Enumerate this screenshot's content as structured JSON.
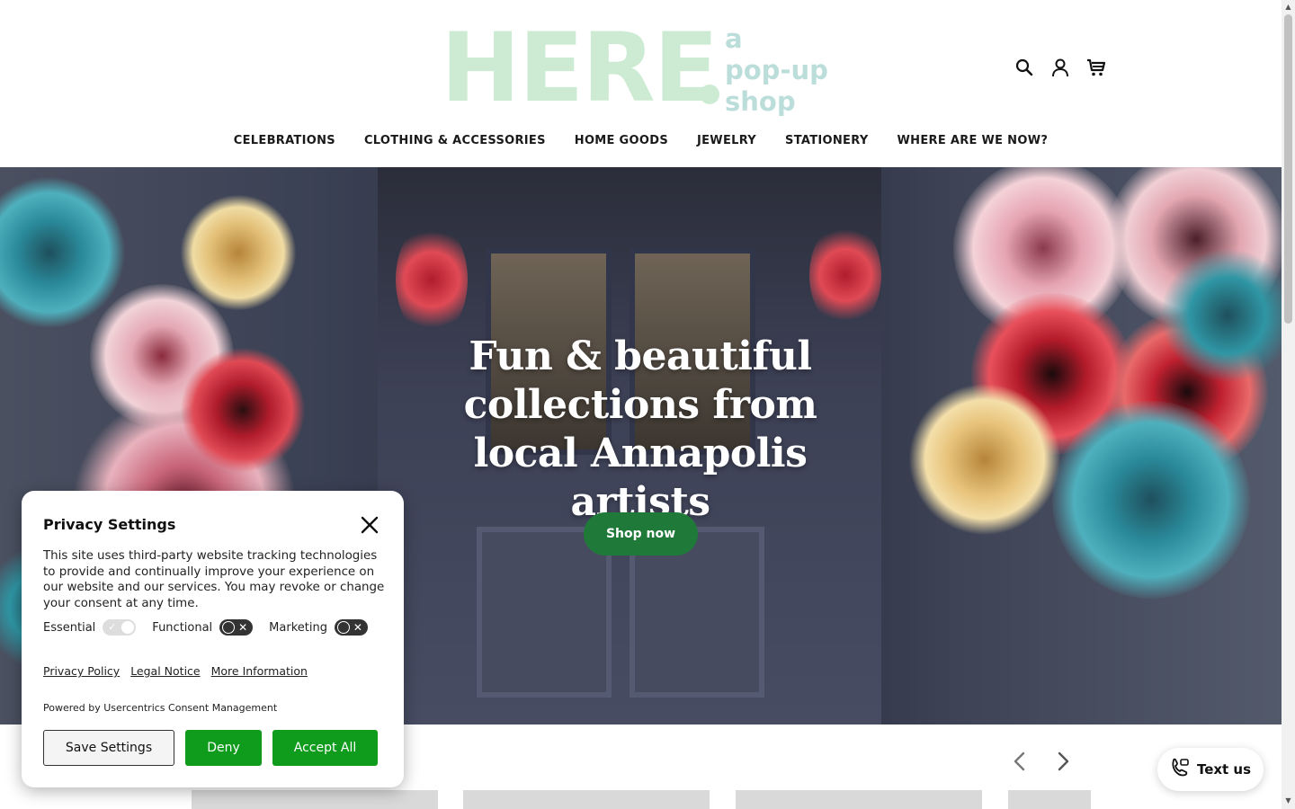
{
  "header": {
    "logo_main": "HERE",
    "logo_sub_lines": [
      "a",
      "pop-up",
      "shop"
    ],
    "icons": [
      "search-icon",
      "account-icon",
      "cart-icon"
    ]
  },
  "nav": {
    "items": [
      {
        "label": "CELEBRATIONS"
      },
      {
        "label": "CLOTHING & ACCESSORIES"
      },
      {
        "label": "HOME GOODS"
      },
      {
        "label": "JEWELRY"
      },
      {
        "label": "STATIONERY"
      },
      {
        "label": "WHERE ARE WE NOW?"
      }
    ]
  },
  "hero": {
    "title": "Fun & beautiful collections from local Annapolis artists",
    "cta_label": "Shop now"
  },
  "carousel": {
    "prev_icon": "chevron-left-icon",
    "next_icon": "chevron-right-icon"
  },
  "text_us": {
    "label": "Text us",
    "icon": "phone-message-icon"
  },
  "privacy": {
    "title": "Privacy Settings",
    "body": "This site uses third-party website tracking technologies to provide and continually improve your experience on our website and our services. You may revoke or change your consent at any time.",
    "toggles": [
      {
        "label": "Essential",
        "state": "on-locked"
      },
      {
        "label": "Functional",
        "state": "off"
      },
      {
        "label": "Marketing",
        "state": "off"
      }
    ],
    "links": [
      {
        "label": "Privacy Policy"
      },
      {
        "label": "Legal Notice"
      },
      {
        "label": "More Information"
      }
    ],
    "powered_by": "Powered by Usercentrics Consent Management",
    "buttons": {
      "save": "Save Settings",
      "deny": "Deny",
      "accept": "Accept All"
    }
  },
  "colors": {
    "logo_green": "#cdebd3",
    "logo_teal": "#bcdedb",
    "cta_green": "#1f7a3a",
    "consent_green": "#0f9b1b"
  }
}
